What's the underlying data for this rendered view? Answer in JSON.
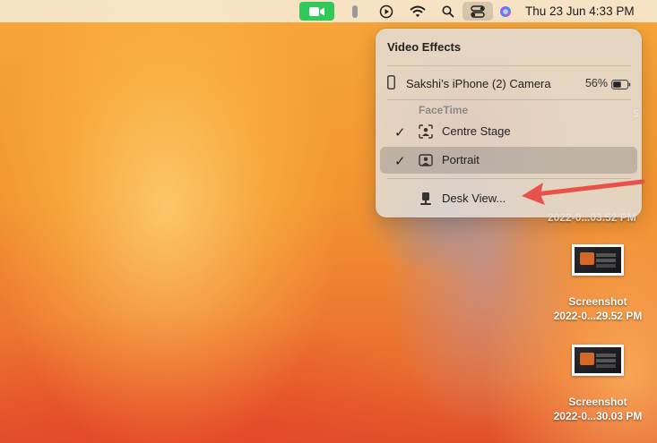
{
  "menubar": {
    "clock": "Thu 23 Jun  4:33 PM",
    "icons": [
      "facetime-video-icon",
      "microphone-indicator-icon",
      "play-circle-icon",
      "wifi-icon",
      "search-icon",
      "control-center-icon",
      "siri-icon"
    ],
    "facetime_color": "#31c95a"
  },
  "panel": {
    "title": "Video Effects",
    "device": {
      "name": "Sakshi’s iPhone (2) Camera",
      "battery": "56%"
    },
    "section": "FaceTime",
    "options": [
      {
        "label": "Centre Stage",
        "checked": true,
        "icon": "centre-stage-icon"
      },
      {
        "label": "Portrait",
        "checked": true,
        "selected": true,
        "icon": "portrait-icon"
      },
      {
        "label": "Desk View...",
        "checked": false,
        "icon": "desk-view-icon"
      }
    ]
  },
  "desktop": {
    "partial_labels": [
      "2022-0...03.52 PM"
    ],
    "files": [
      {
        "line1": "Screenshot",
        "line2": "2022-0...29.52 PM"
      },
      {
        "line1": "Screenshot",
        "line2": "2022-0...30.03 PM"
      }
    ]
  },
  "annotation": {
    "arrow_color": "#e8514a"
  }
}
